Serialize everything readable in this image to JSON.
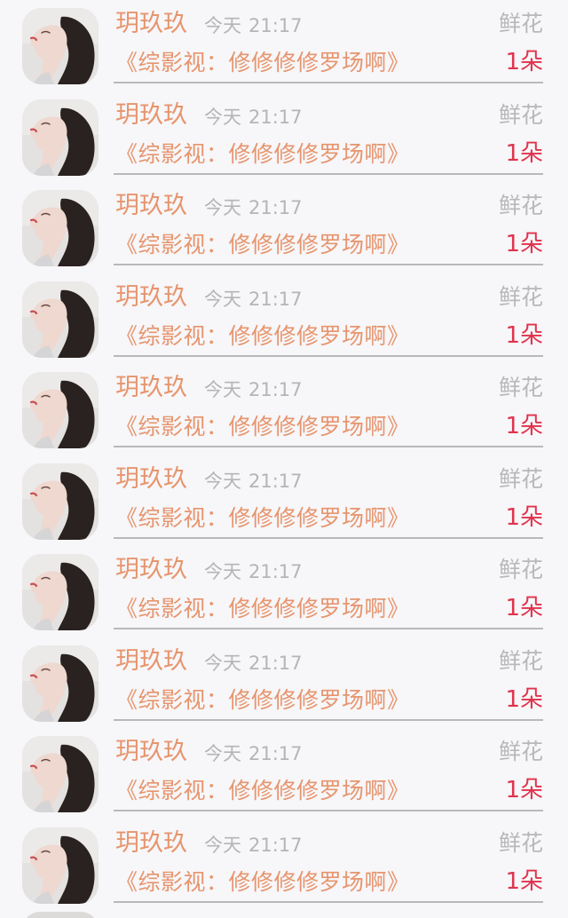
{
  "rows": [
    {
      "name": "玥玖玖",
      "day": "今天",
      "time": "21:17",
      "gift_label": "鲜花",
      "message": "《综影视：修修修修罗场啊》",
      "count": "1朵"
    },
    {
      "name": "玥玖玖",
      "day": "今天",
      "time": "21:17",
      "gift_label": "鲜花",
      "message": "《综影视：修修修修罗场啊》",
      "count": "1朵"
    },
    {
      "name": "玥玖玖",
      "day": "今天",
      "time": "21:17",
      "gift_label": "鲜花",
      "message": "《综影视：修修修修罗场啊》",
      "count": "1朵"
    },
    {
      "name": "玥玖玖",
      "day": "今天",
      "time": "21:17",
      "gift_label": "鲜花",
      "message": "《综影视：修修修修罗场啊》",
      "count": "1朵"
    },
    {
      "name": "玥玖玖",
      "day": "今天",
      "time": "21:17",
      "gift_label": "鲜花",
      "message": "《综影视：修修修修罗场啊》",
      "count": "1朵"
    },
    {
      "name": "玥玖玖",
      "day": "今天",
      "time": "21:17",
      "gift_label": "鲜花",
      "message": "《综影视：修修修修罗场啊》",
      "count": "1朵"
    },
    {
      "name": "玥玖玖",
      "day": "今天",
      "time": "21:17",
      "gift_label": "鲜花",
      "message": "《综影视：修修修修罗场啊》",
      "count": "1朵"
    },
    {
      "name": "玥玖玖",
      "day": "今天",
      "time": "21:17",
      "gift_label": "鲜花",
      "message": "《综影视：修修修修罗场啊》",
      "count": "1朵"
    },
    {
      "name": "玥玖玖",
      "day": "今天",
      "time": "21:17",
      "gift_label": "鲜花",
      "message": "《综影视：修修修修罗场啊》",
      "count": "1朵"
    },
    {
      "name": "玥玖玖",
      "day": "今天",
      "time": "21:17",
      "gift_label": "鲜花",
      "message": "《综影视：修修修修罗场啊》",
      "count": "1朵"
    }
  ],
  "colors": {
    "name": "#e6956e",
    "message": "#e6956e",
    "count": "#e0334d",
    "muted": "#b5b5b7",
    "background": "#f7f6f8"
  },
  "icons": {
    "avatar": "user-avatar-photo"
  }
}
